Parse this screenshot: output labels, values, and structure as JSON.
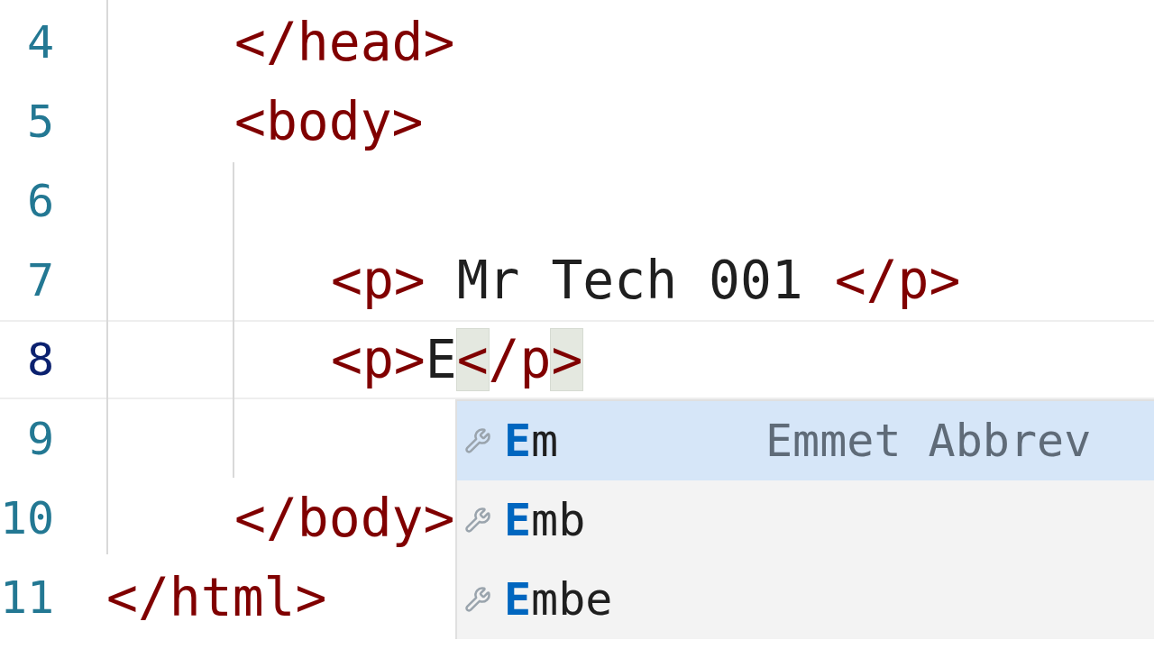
{
  "editor": {
    "lines": [
      {
        "children": [
          {
            "number": "4",
            "current": false,
            "tokens": [
              {
                "kind": "tag",
                "text": "</head>"
              }
            ]
          },
          {
            "number": "5",
            "current": false,
            "tokens": [
              {
                "kind": "tag",
                "text": "<body>"
              }
            ],
            "children": [
              {
                "number": "6",
                "current": false
              },
              {
                "number": "7",
                "current": false,
                "tokens": [
                  {
                    "kind": "tag",
                    "text": "<p>"
                  },
                  {
                    "kind": "text",
                    "text": " Mr Tech 001 "
                  },
                  {
                    "kind": "tag",
                    "text": "</p>"
                  }
                ]
              },
              {
                "number": "8",
                "current": true,
                "tokens": [
                  {
                    "kind": "tag",
                    "text": "<p>"
                  },
                  {
                    "kind": "text",
                    "text": "E"
                  },
                  {
                    "kind": "tag",
                    "text": "<",
                    "matched": true
                  },
                  {
                    "kind": "tag",
                    "text": "/p"
                  },
                  {
                    "kind": "tag",
                    "text": ">",
                    "matched": true
                  }
                ]
              },
              {
                "number": "9",
                "current": false
              }
            ]
          },
          {
            "number": "10",
            "current": false,
            "tokens": [
              {
                "kind": "tag",
                "text": "</body>"
              }
            ]
          }
        ]
      },
      {
        "number": "11",
        "current": false,
        "tokens": [
          {
            "kind": "tag",
            "text": "</html>"
          }
        ]
      }
    ]
  },
  "suggestions": {
    "items": [
      {
        "match": "E",
        "rest": "m",
        "detail": "Emmet Abbrev",
        "selected": true
      },
      {
        "match": "E",
        "rest": "mb",
        "selected": false
      },
      {
        "match": "E",
        "rest": "mbe",
        "selected": false
      }
    ]
  }
}
